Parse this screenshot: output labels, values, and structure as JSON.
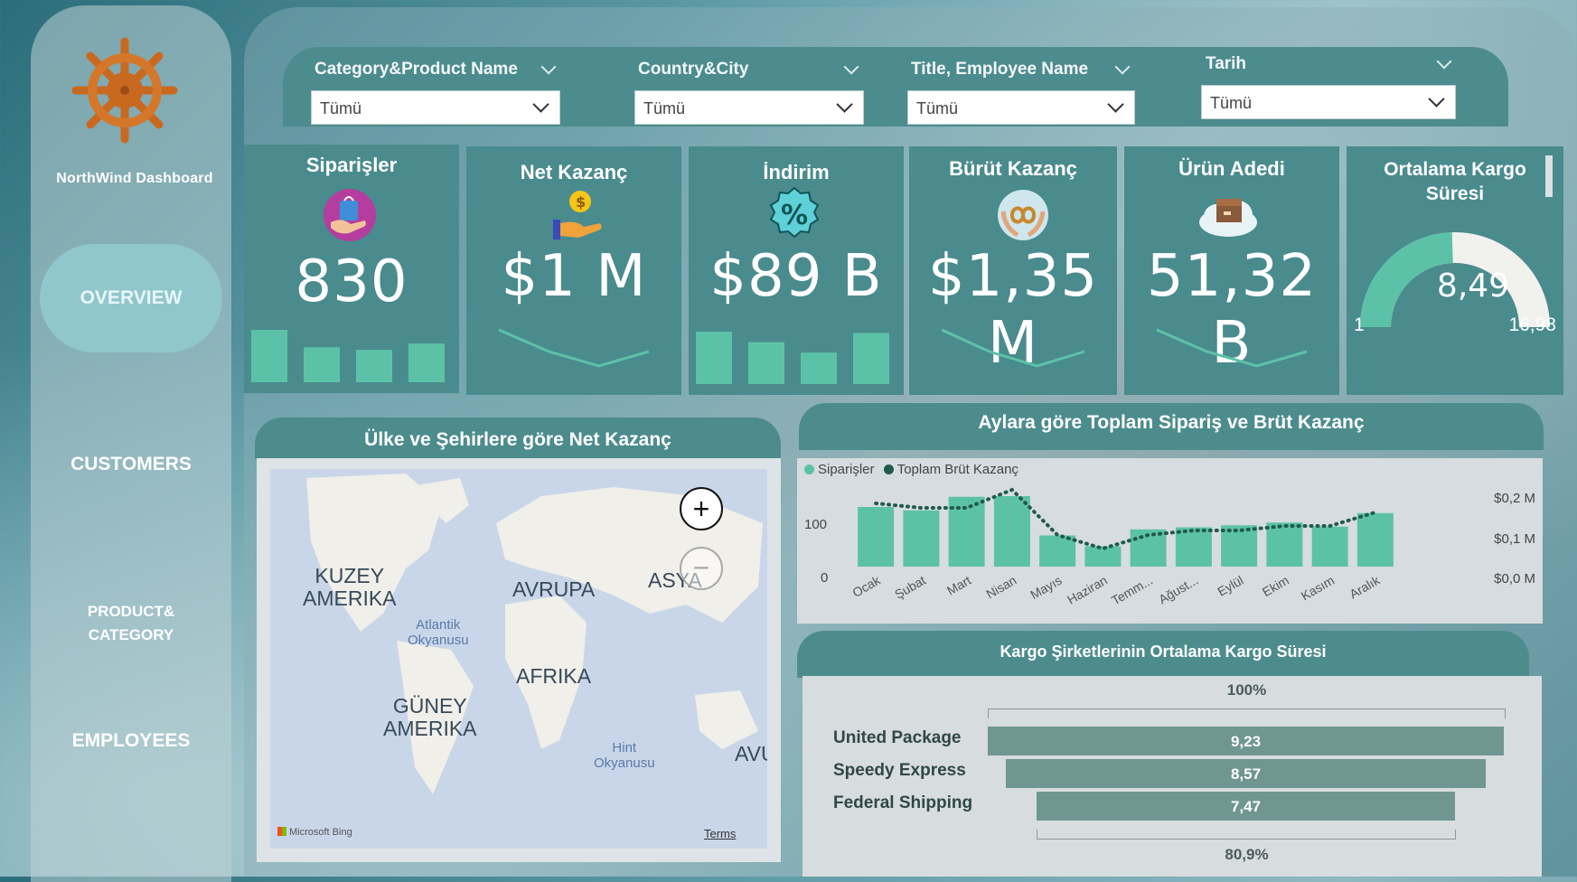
{
  "sidebar": {
    "brand": "NorthWind  Dashboard",
    "items": [
      {
        "label": "OVERVIEW",
        "active": true
      },
      {
        "label": "CUSTOMERS"
      },
      {
        "label": "PRODUCT&"
      },
      {
        "label": "CATEGORY"
      },
      {
        "label": "EMPLOYEES"
      }
    ]
  },
  "filters": [
    {
      "title": "Category&Product Name",
      "value": "Tümü"
    },
    {
      "title": "Country&City",
      "value": "Tümü"
    },
    {
      "title": "Title, Employee Name",
      "value": "Tümü"
    },
    {
      "title": "Tarih",
      "value": "Tümü"
    }
  ],
  "kpis": [
    {
      "title": "Siparişler",
      "value": "830",
      "icon": "shopping-bag-icon",
      "spark": "bar",
      "spark_values": [
        42,
        28,
        26,
        31
      ]
    },
    {
      "title": "Net Kazanç",
      "value": "$1 M",
      "icon": "money-hand-icon",
      "spark": "line",
      "spark_values": [
        6,
        3,
        1,
        3
      ]
    },
    {
      "title": "İndirim",
      "value": "$89 B",
      "icon": "percent-icon",
      "spark": "bar",
      "spark_values": [
        40,
        32,
        24,
        39
      ]
    },
    {
      "title": "Bürüt Kazanç",
      "value": "$1,35 M",
      "icon": "infinity-hands-icon",
      "spark": "line",
      "spark_values": [
        6,
        3,
        1,
        3
      ]
    },
    {
      "title": "Ürün Adedi",
      "value": "51,32 B",
      "icon": "cloud-box-icon",
      "spark": "line",
      "spark_values": [
        6,
        3,
        1,
        3
      ]
    }
  ],
  "gauge": {
    "title": "Ortalama Kargo Süresi",
    "value": "8,49",
    "min": "1",
    "max": "16,98",
    "fraction": 0.49
  },
  "map": {
    "title": "Ülke ve Şehirlere göre Net Kazanç",
    "labels": [
      "KUZEY",
      "AMERIKA",
      "AVRUPA",
      "ASYA",
      "AFRIKA",
      "GÜNEY",
      "AMERIKA",
      "Atlantik",
      "Okyanusu",
      "Hint",
      "Okyanusu",
      "AVU"
    ],
    "attribution": "Microsoft Bing",
    "terms": "Terms"
  },
  "monthly": {
    "title": "Aylara göre Toplam Sipariş ve Brüt Kazanç",
    "legend": [
      "Siparişler",
      "Toplam Brüt Kazanç"
    ],
    "left_ticks": [
      "100",
      "0"
    ],
    "right_ticks": [
      "$0,2 M",
      "$0,1 M",
      "$0,0 M"
    ]
  },
  "chart_data": {
    "type": "bar",
    "categories": [
      "Ocak",
      "Şubat",
      "Mart",
      "Nisan",
      "Mayıs",
      "Haziran",
      "Temm...",
      "Ağust...",
      "Eylül",
      "Ekim",
      "Kasım",
      "Aralık"
    ],
    "series": [
      {
        "name": "Siparişler",
        "type": "bar",
        "values": [
          88,
          83,
          103,
          104,
          46,
          30,
          55,
          58,
          61,
          65,
          59,
          79
        ]
      },
      {
        "name": "Toplam Brüt Kazanç",
        "type": "line",
        "values": [
          0.14,
          0.13,
          0.13,
          0.17,
          0.07,
          0.04,
          0.07,
          0.08,
          0.08,
          0.09,
          0.09,
          0.12
        ]
      }
    ],
    "ylim_left": [
      0,
      120
    ],
    "ylim_right": [
      0,
      0.22
    ]
  },
  "shipping": {
    "title": "Kargo Şirketlerinin Ortalama Kargo Süresi",
    "top_label": "100%",
    "bottom_label": "80,9%",
    "rows": [
      {
        "name": "United Package",
        "value": "9,23",
        "v": 9.23
      },
      {
        "name": "Speedy Express",
        "value": "8,57",
        "v": 8.57
      },
      {
        "name": "Federal Shipping",
        "value": "7,47",
        "v": 7.47
      }
    ]
  },
  "colors": {
    "teal": "#4a8b8d",
    "mint": "#5cc2a7",
    "dark": "#1f5a4d",
    "funnel": "#6f9690"
  }
}
